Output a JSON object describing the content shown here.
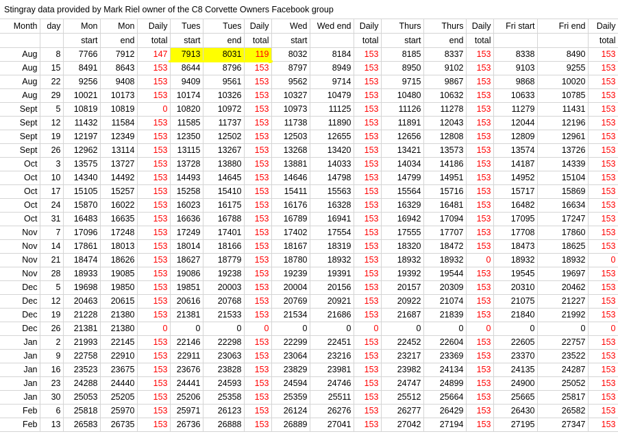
{
  "title": "Stingray data provided by Mark Riel owner of the C8 Corvette Owners Facebook group",
  "header_row1": [
    "Month",
    "day",
    "Mon",
    "Mon",
    "Daily",
    "Tues",
    "Tues",
    "Daily",
    "Wed",
    "Wed end",
    "Daily",
    "Thurs",
    "Thurs",
    "Daily",
    "Fri start",
    "Fri end",
    "Daily"
  ],
  "header_row2": [
    "",
    "",
    "start",
    "end",
    "total",
    "start",
    "end",
    "total",
    "start",
    "",
    "total",
    "start",
    "end",
    "total",
    "",
    "",
    "total"
  ],
  "rows": [
    [
      "Aug",
      "8",
      "7766",
      "7912",
      "147",
      "7913",
      "8031",
      "119",
      "8032",
      "8184",
      "153",
      "8185",
      "8337",
      "153",
      "8338",
      "8490",
      "153"
    ],
    [
      "Aug",
      "15",
      "8491",
      "8643",
      "153",
      "8644",
      "8796",
      "153",
      "8797",
      "8949",
      "153",
      "8950",
      "9102",
      "153",
      "9103",
      "9255",
      "153"
    ],
    [
      "Aug",
      "22",
      "9256",
      "9408",
      "153",
      "9409",
      "9561",
      "153",
      "9562",
      "9714",
      "153",
      "9715",
      "9867",
      "153",
      "9868",
      "10020",
      "153"
    ],
    [
      "Aug",
      "29",
      "10021",
      "10173",
      "153",
      "10174",
      "10326",
      "153",
      "10327",
      "10479",
      "153",
      "10480",
      "10632",
      "153",
      "10633",
      "10785",
      "153"
    ],
    [
      "Sept",
      "5",
      "10819",
      "10819",
      "0",
      "10820",
      "10972",
      "153",
      "10973",
      "11125",
      "153",
      "11126",
      "11278",
      "153",
      "11279",
      "11431",
      "153"
    ],
    [
      "Sept",
      "12",
      "11432",
      "11584",
      "153",
      "11585",
      "11737",
      "153",
      "11738",
      "11890",
      "153",
      "11891",
      "12043",
      "153",
      "12044",
      "12196",
      "153"
    ],
    [
      "Sept",
      "19",
      "12197",
      "12349",
      "153",
      "12350",
      "12502",
      "153",
      "12503",
      "12655",
      "153",
      "12656",
      "12808",
      "153",
      "12809",
      "12961",
      "153"
    ],
    [
      "Sept",
      "26",
      "12962",
      "13114",
      "153",
      "13115",
      "13267",
      "153",
      "13268",
      "13420",
      "153",
      "13421",
      "13573",
      "153",
      "13574",
      "13726",
      "153"
    ],
    [
      "Oct",
      "3",
      "13575",
      "13727",
      "153",
      "13728",
      "13880",
      "153",
      "13881",
      "14033",
      "153",
      "14034",
      "14186",
      "153",
      "14187",
      "14339",
      "153"
    ],
    [
      "Oct",
      "10",
      "14340",
      "14492",
      "153",
      "14493",
      "14645",
      "153",
      "14646",
      "14798",
      "153",
      "14799",
      "14951",
      "153",
      "14952",
      "15104",
      "153"
    ],
    [
      "Oct",
      "17",
      "15105",
      "15257",
      "153",
      "15258",
      "15410",
      "153",
      "15411",
      "15563",
      "153",
      "15564",
      "15716",
      "153",
      "15717",
      "15869",
      "153"
    ],
    [
      "Oct",
      "24",
      "15870",
      "16022",
      "153",
      "16023",
      "16175",
      "153",
      "16176",
      "16328",
      "153",
      "16329",
      "16481",
      "153",
      "16482",
      "16634",
      "153"
    ],
    [
      "Oct",
      "31",
      "16483",
      "16635",
      "153",
      "16636",
      "16788",
      "153",
      "16789",
      "16941",
      "153",
      "16942",
      "17094",
      "153",
      "17095",
      "17247",
      "153"
    ],
    [
      "Nov",
      "7",
      "17096",
      "17248",
      "153",
      "17249",
      "17401",
      "153",
      "17402",
      "17554",
      "153",
      "17555",
      "17707",
      "153",
      "17708",
      "17860",
      "153"
    ],
    [
      "Nov",
      "14",
      "17861",
      "18013",
      "153",
      "18014",
      "18166",
      "153",
      "18167",
      "18319",
      "153",
      "18320",
      "18472",
      "153",
      "18473",
      "18625",
      "153"
    ],
    [
      "Nov",
      "21",
      "18474",
      "18626",
      "153",
      "18627",
      "18779",
      "153",
      "18780",
      "18932",
      "153",
      "18932",
      "18932",
      "0",
      "18932",
      "18932",
      "0"
    ],
    [
      "Nov",
      "28",
      "18933",
      "19085",
      "153",
      "19086",
      "19238",
      "153",
      "19239",
      "19391",
      "153",
      "19392",
      "19544",
      "153",
      "19545",
      "19697",
      "153"
    ],
    [
      "Dec",
      "5",
      "19698",
      "19850",
      "153",
      "19851",
      "20003",
      "153",
      "20004",
      "20156",
      "153",
      "20157",
      "20309",
      "153",
      "20310",
      "20462",
      "153"
    ],
    [
      "Dec",
      "12",
      "20463",
      "20615",
      "153",
      "20616",
      "20768",
      "153",
      "20769",
      "20921",
      "153",
      "20922",
      "21074",
      "153",
      "21075",
      "21227",
      "153"
    ],
    [
      "Dec",
      "19",
      "21228",
      "21380",
      "153",
      "21381",
      "21533",
      "153",
      "21534",
      "21686",
      "153",
      "21687",
      "21839",
      "153",
      "21840",
      "21992",
      "153"
    ],
    [
      "Dec",
      "26",
      "21381",
      "21380",
      "0",
      "0",
      "0",
      "0",
      "0",
      "0",
      "0",
      "0",
      "0",
      "0",
      "0",
      "0",
      "0"
    ],
    [
      "Jan",
      "2",
      "21993",
      "22145",
      "153",
      "22146",
      "22298",
      "153",
      "22299",
      "22451",
      "153",
      "22452",
      "22604",
      "153",
      "22605",
      "22757",
      "153"
    ],
    [
      "Jan",
      "9",
      "22758",
      "22910",
      "153",
      "22911",
      "23063",
      "153",
      "23064",
      "23216",
      "153",
      "23217",
      "23369",
      "153",
      "23370",
      "23522",
      "153"
    ],
    [
      "Jan",
      "16",
      "23523",
      "23675",
      "153",
      "23676",
      "23828",
      "153",
      "23829",
      "23981",
      "153",
      "23982",
      "24134",
      "153",
      "24135",
      "24287",
      "153"
    ],
    [
      "Jan",
      "23",
      "24288",
      "24440",
      "153",
      "24441",
      "24593",
      "153",
      "24594",
      "24746",
      "153",
      "24747",
      "24899",
      "153",
      "24900",
      "25052",
      "153"
    ],
    [
      "Jan",
      "30",
      "25053",
      "25205",
      "153",
      "25206",
      "25358",
      "153",
      "25359",
      "25511",
      "153",
      "25512",
      "25664",
      "153",
      "25665",
      "25817",
      "153"
    ],
    [
      "Feb",
      "6",
      "25818",
      "25970",
      "153",
      "25971",
      "26123",
      "153",
      "26124",
      "26276",
      "153",
      "26277",
      "26429",
      "153",
      "26430",
      "26582",
      "153"
    ],
    [
      "Feb",
      "13",
      "26583",
      "26735",
      "153",
      "26736",
      "26888",
      "153",
      "26889",
      "27041",
      "153",
      "27042",
      "27194",
      "153",
      "27195",
      "27347",
      "153"
    ]
  ],
  "colors": {
    "daily_total": "#ff0000",
    "highlight": "#ffff00",
    "gridline": "#d4d4d4"
  }
}
